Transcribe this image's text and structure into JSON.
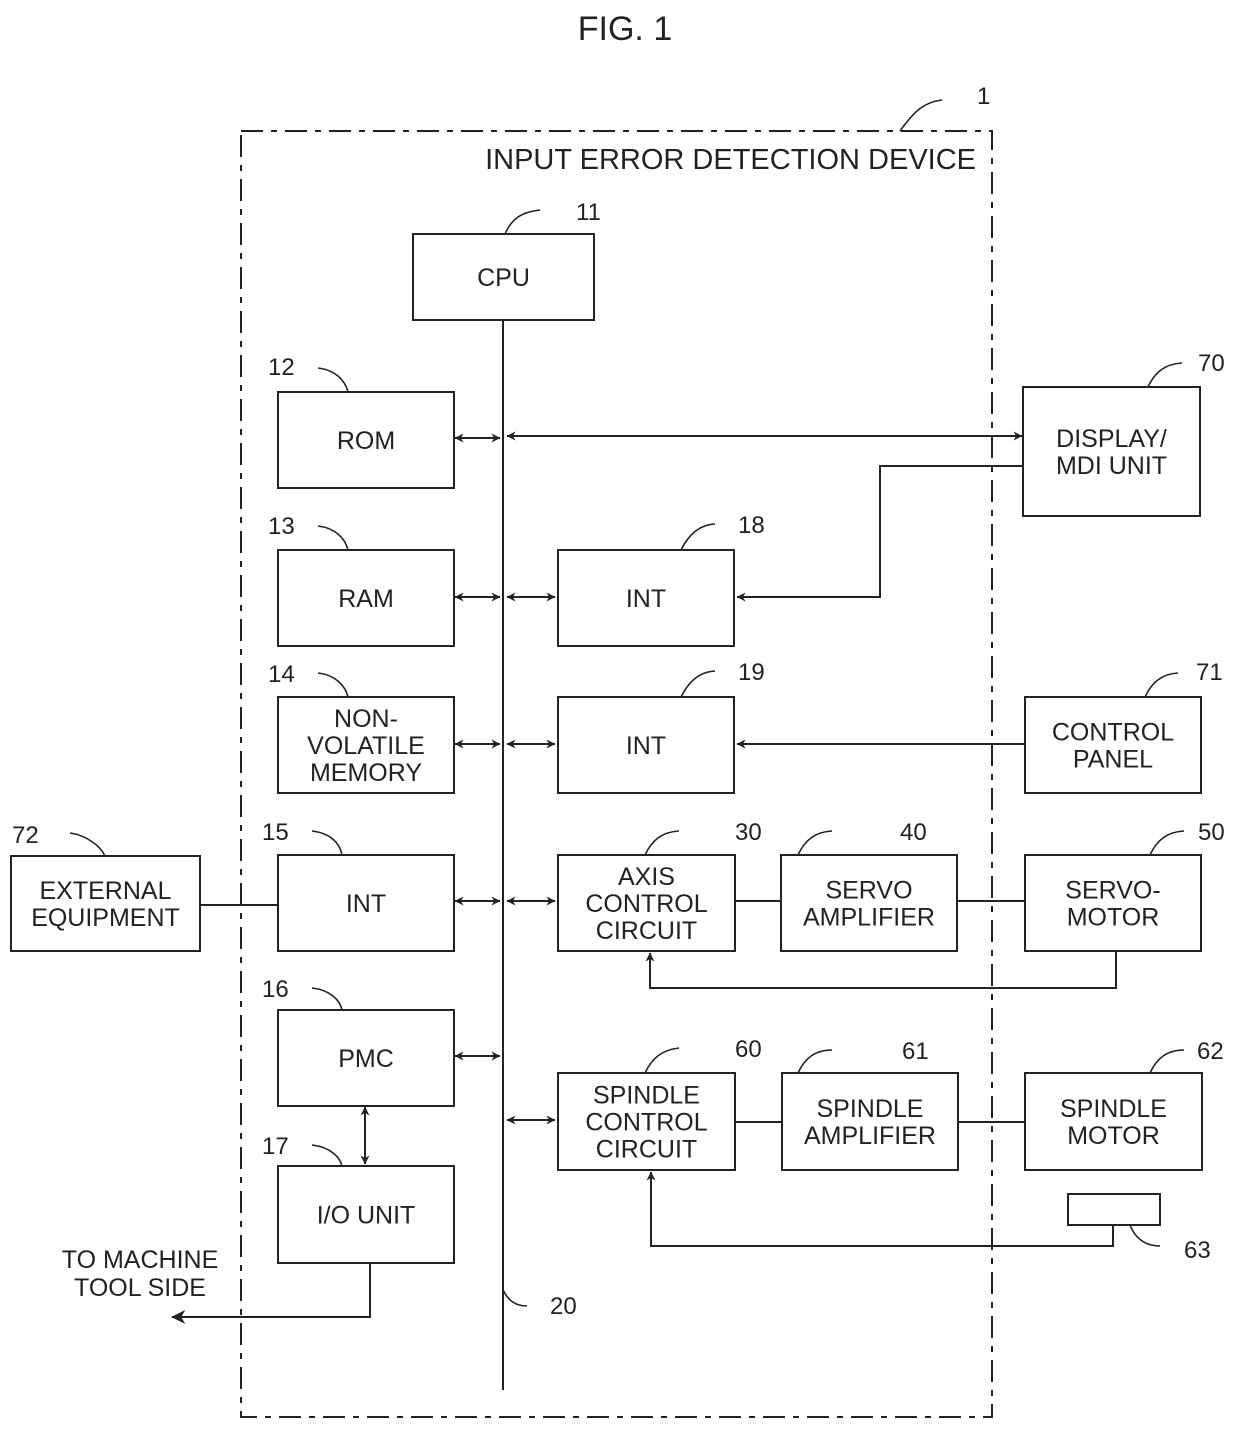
{
  "figure_title": "FIG. 1",
  "device": {
    "title": "INPUT ERROR DETECTION DEVICE",
    "ref": "1"
  },
  "bus": {
    "ref": "20"
  },
  "blocks": {
    "cpu": {
      "lines": [
        "CPU"
      ],
      "ref": "11"
    },
    "rom": {
      "lines": [
        "ROM"
      ],
      "ref": "12"
    },
    "ram": {
      "lines": [
        "RAM"
      ],
      "ref": "13"
    },
    "nvm": {
      "lines": [
        "NON-",
        "VOLATILE",
        "MEMORY"
      ],
      "ref": "14"
    },
    "int15": {
      "lines": [
        "INT"
      ],
      "ref": "15"
    },
    "pmc": {
      "lines": [
        "PMC"
      ],
      "ref": "16"
    },
    "io": {
      "lines": [
        "I/O UNIT"
      ],
      "ref": "17"
    },
    "int18": {
      "lines": [
        "INT"
      ],
      "ref": "18"
    },
    "int19": {
      "lines": [
        "INT"
      ],
      "ref": "19"
    },
    "axis": {
      "lines": [
        "AXIS",
        "CONTROL",
        "CIRCUIT"
      ],
      "ref": "30"
    },
    "servoamp": {
      "lines": [
        "SERVO",
        "AMPLIFIER"
      ],
      "ref": "40"
    },
    "servomotor": {
      "lines": [
        "SERVO-",
        "MOTOR"
      ],
      "ref": "50"
    },
    "spindlectl": {
      "lines": [
        "SPINDLE",
        "CONTROL",
        "CIRCUIT"
      ],
      "ref": "60"
    },
    "spindleamp": {
      "lines": [
        "SPINDLE",
        "AMPLIFIER"
      ],
      "ref": "61"
    },
    "spindlemotor": {
      "lines": [
        "SPINDLE",
        "MOTOR"
      ],
      "ref": "62"
    },
    "sensor": {
      "lines": [],
      "ref": "63"
    },
    "display": {
      "lines": [
        "DISPLAY/",
        "MDI UNIT"
      ],
      "ref": "70"
    },
    "panel": {
      "lines": [
        "CONTROL",
        "PANEL"
      ],
      "ref": "71"
    },
    "external": {
      "lines": [
        "EXTERNAL",
        "EQUIPMENT"
      ],
      "ref": "72"
    }
  },
  "machine_side_label": [
    "TO MACHINE",
    "TOOL SIDE"
  ]
}
